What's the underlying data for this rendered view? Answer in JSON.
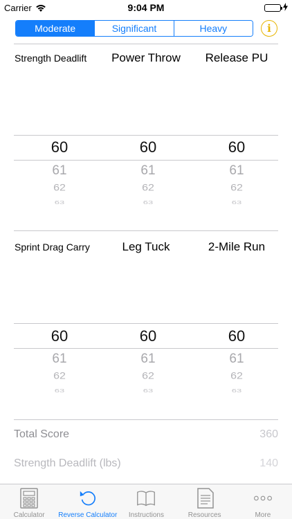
{
  "status": {
    "carrier": "Carrier",
    "time": "9:04 PM"
  },
  "segments": {
    "items": [
      "Moderate",
      "Significant",
      "Heavy"
    ],
    "active": "Moderate"
  },
  "info": {
    "glyph": "i"
  },
  "picker1": {
    "labels": [
      "Strength Deadlift",
      "Power Throw",
      "Release PU"
    ],
    "selected": [
      "60",
      "60",
      "60"
    ],
    "next1": [
      "61",
      "61",
      "61"
    ],
    "next2": [
      "62",
      "62",
      "62"
    ],
    "next3": [
      "63",
      "63",
      "63"
    ]
  },
  "picker2": {
    "labels": [
      "Sprint Drag Carry",
      "Leg Tuck",
      "2-Mile Run"
    ],
    "selected": [
      "60",
      "60",
      "60"
    ],
    "next1": [
      "61",
      "61",
      "61"
    ],
    "next2": [
      "62",
      "62",
      "62"
    ],
    "next3": [
      "63",
      "63",
      "63"
    ]
  },
  "results": [
    {
      "label": "Total Score",
      "value": "360"
    },
    {
      "label": "Strength Deadlift (lbs)",
      "value": "140"
    }
  ],
  "tabs": [
    {
      "label": "Calculator",
      "icon": "calculator-icon"
    },
    {
      "label": "Reverse Calculator",
      "icon": "refresh-icon"
    },
    {
      "label": "Instructions",
      "icon": "book-icon"
    },
    {
      "label": "Resources",
      "icon": "document-icon"
    },
    {
      "label": "More",
      "icon": "more-icon"
    }
  ],
  "colors": {
    "accent": "#147efb",
    "info": "#e7b400"
  }
}
